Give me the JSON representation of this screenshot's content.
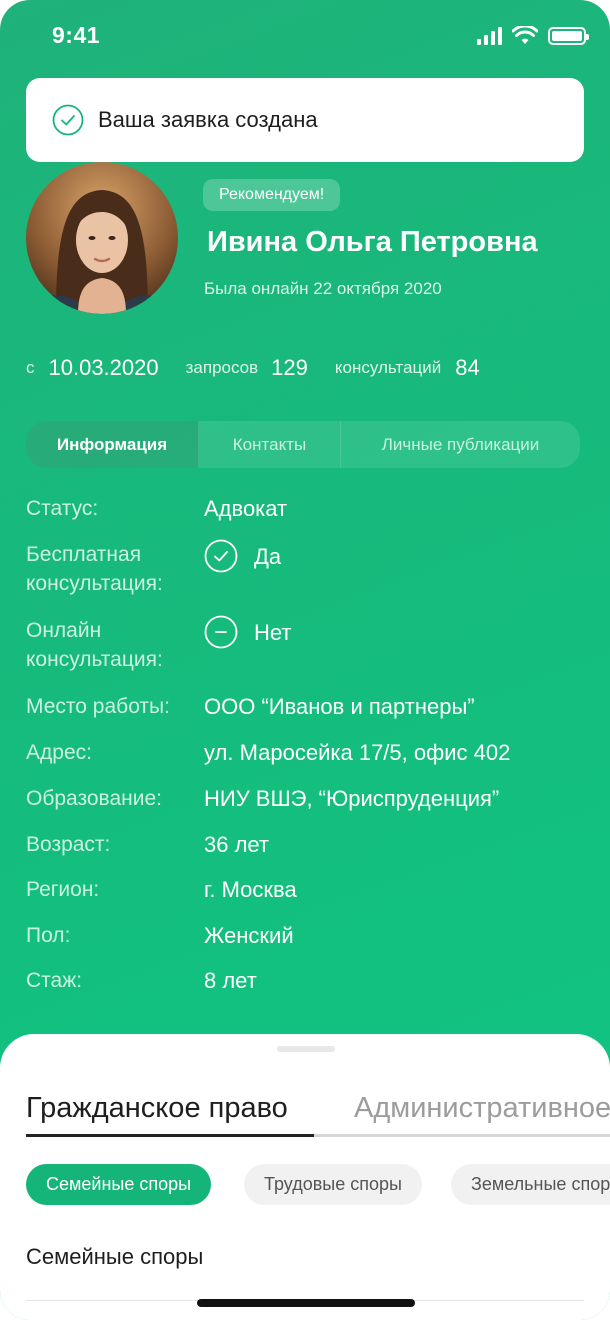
{
  "status_bar": {
    "time": "9:41"
  },
  "toast": {
    "text": "Ваша заявка создана",
    "icon": "check-circle-icon"
  },
  "profile": {
    "badge": "Рекомендуем!",
    "name": "Ивина Ольга Петровна",
    "last_online": "Была онлайн 22 октября 2020"
  },
  "stats": {
    "since_label": "с",
    "since_value": "10.03.2020",
    "requests_label": "запросов",
    "requests_value": "129",
    "consultations_label": "консультаций",
    "consultations_value": "84"
  },
  "tabs": [
    {
      "label": "Информация",
      "active": true
    },
    {
      "label": "Контакты",
      "active": false
    },
    {
      "label": "Личные публикации",
      "active": false
    }
  ],
  "info": {
    "status": {
      "label": "Статус:",
      "value": "Адвокат"
    },
    "free_consult": {
      "label": "Бесплатная консультация:",
      "value": "Да",
      "icon": "check-circle-icon"
    },
    "online_consult": {
      "label": "Онлайн консультация:",
      "value": "Нет",
      "icon": "minus-circle-icon"
    },
    "workplace": {
      "label": "Место работы:",
      "value": "ООО “Иванов и партнеры”"
    },
    "address": {
      "label": "Адрес:",
      "value": "ул. Маросейка 17/5, офис 402"
    },
    "education": {
      "label": "Образование:",
      "value": "НИУ ВШЭ, “Юриспруденция”"
    },
    "age": {
      "label": "Возраст:",
      "value": "36 лет"
    },
    "region": {
      "label": "Регион:",
      "value": "г. Москва"
    },
    "gender": {
      "label": "Пол:",
      "value": "Женский"
    },
    "experience": {
      "label": "Стаж:",
      "value": "8 лет"
    }
  },
  "sheet": {
    "category_tabs": [
      {
        "label": "Гражданское право",
        "active": true
      },
      {
        "label": "Административное право",
        "active": false
      }
    ],
    "chips": [
      {
        "label": "Семейные споры",
        "active": true
      },
      {
        "label": "Трудовые споры",
        "active": false
      },
      {
        "label": "Земельные споры",
        "active": false
      }
    ],
    "section_title": "Семейные споры"
  },
  "colors": {
    "accent": "#15b57a",
    "background_gradient_start": "#1fb27a",
    "background_gradient_end": "#0fc683"
  }
}
